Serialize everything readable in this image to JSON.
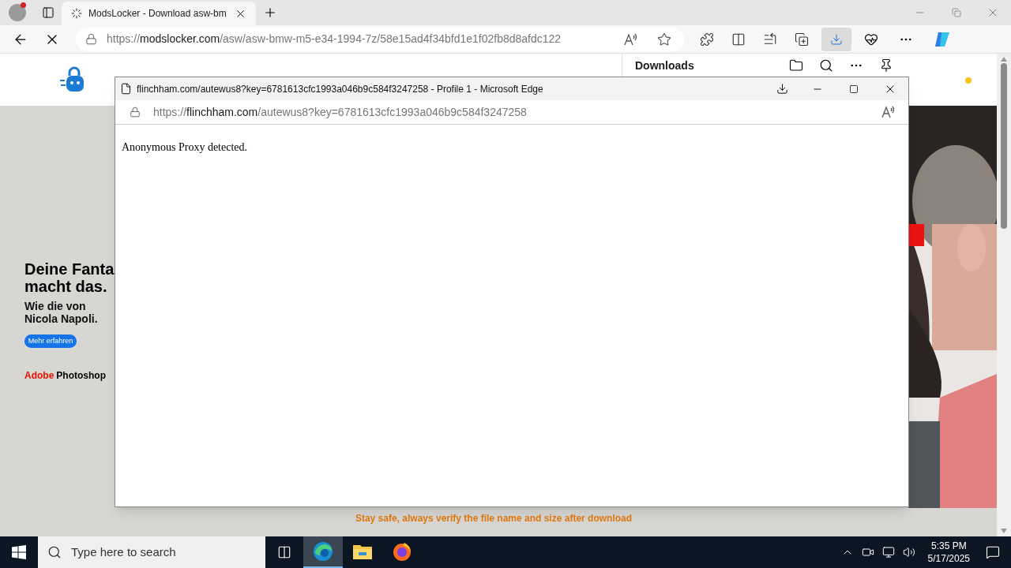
{
  "browser": {
    "tabs": [
      {
        "title": "ModsLocker - Download asw-bm",
        "selected": true
      }
    ],
    "url": {
      "prefix": "https://",
      "host": "modslocker.com",
      "path": "/asw/asw-bmw-m5-e34-1994-7z/58e15ad4f34bfd1e1f02fb8d8afdc122"
    },
    "downloads_active": true
  },
  "downloads_panel": {
    "title": "Downloads"
  },
  "page": {
    "ad": {
      "headline": [
        "Deine Fanta",
        "macht das."
      ],
      "subline": [
        "Wie die von",
        "Nicola Napoli."
      ],
      "button": "Mehr erfahren",
      "brand": "Adobe",
      "product": "Photoshop"
    },
    "notice": "Stay safe, always verify the file name and size after download"
  },
  "popup": {
    "title": "flinchham.com/autewus8?key=6781613cfc1993a046b9c584f3247258 - Profile 1 - Microsoft Edge",
    "url": {
      "prefix": "https://",
      "host": "flinchham.com",
      "path": "/autewus8?key=6781613cfc1993a046b9c584f3247258"
    },
    "body": "Anonymous Proxy detected."
  },
  "taskbar": {
    "search_placeholder": "Type here to search",
    "apps": [
      {
        "kind": "edge",
        "selected": true
      },
      {
        "kind": "explorer",
        "selected": false
      },
      {
        "kind": "firefox",
        "selected": false
      }
    ],
    "time": "5:35 PM",
    "date": "5/17/2025"
  }
}
